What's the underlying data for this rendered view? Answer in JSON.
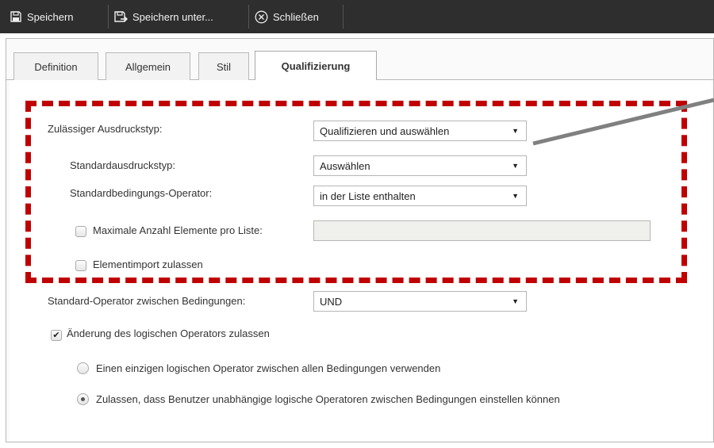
{
  "toolbar": {
    "save_label": "Speichern",
    "save_as_label": "Speichern unter...",
    "close_label": "Schließen"
  },
  "tabs": [
    {
      "label": "Definition"
    },
    {
      "label": "Allgemein"
    },
    {
      "label": "Stil"
    },
    {
      "label": "Qualifizierung",
      "active": true
    }
  ],
  "form": {
    "expression_type_label": "Zulässiger Ausdruckstyp:",
    "expression_type_value": "Qualifizieren und auswählen",
    "default_expression_type_label": "Standardausdruckstyp:",
    "default_expression_type_value": "Auswählen",
    "default_condition_operator_label": "Standardbedingungs-Operator:",
    "default_condition_operator_value": "in der Liste enthalten",
    "max_elements_label": "Maximale Anzahl Elemente pro Liste:",
    "max_elements_checked": false,
    "max_elements_value": "",
    "element_import_label": "Elementimport zulassen",
    "element_import_checked": false,
    "operator_between_label": "Standard-Operator zwischen Bedingungen:",
    "operator_between_value": "UND",
    "allow_change_label": "Änderung des logischen Operators zulassen",
    "allow_change_checked": true,
    "radio_single_label": "Einen einzigen logischen Operator zwischen allen Bedingungen verwenden",
    "radio_independent_label": "Zulassen, dass Benutzer unabhängige logische Operatoren zwischen Bedingungen einstellen können",
    "selected_radio": "independent"
  },
  "colors": {
    "toolbar_bg": "#2e2e2e",
    "highlight_dash": "#c00000",
    "pointer_line": "#808080"
  }
}
